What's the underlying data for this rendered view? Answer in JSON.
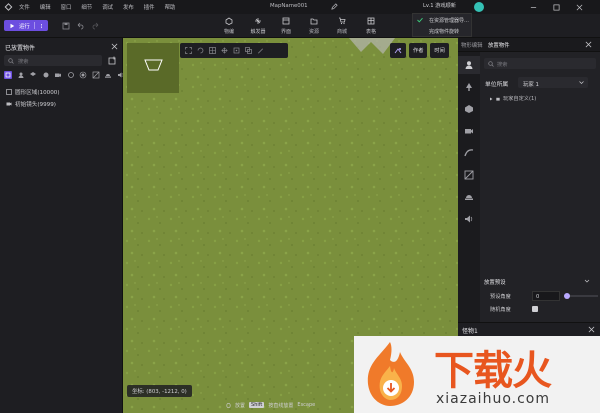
{
  "menubar": {
    "items": [
      "文件",
      "编辑",
      "窗口",
      "细节",
      "调试",
      "发布",
      "插件",
      "帮助"
    ],
    "map_name": "MapName001",
    "level_pill": "Lv.1 游戏顺新"
  },
  "toolbar": {
    "run_label": "运行",
    "tools": [
      "物编",
      "触发器",
      "界面",
      "资源",
      "商城",
      "表格"
    ]
  },
  "notification": {
    "line1": "在资源管理器导…",
    "line2": "完成物件旋转"
  },
  "left_panel": {
    "title": "已放置物件",
    "search_placeholder": "搜索",
    "tree": [
      "圆形区域(10000)",
      "初始镜头(9999)"
    ]
  },
  "viewport": {
    "buttons": [
      "作者",
      "时间"
    ],
    "coords": "坐标:  (803, -1212, 0)"
  },
  "right_panel": {
    "tabs": [
      "物形编辑",
      "放置物件"
    ],
    "search_placeholder": "搜索",
    "owner_label": "单位所属",
    "owner_value": "玩家 1",
    "custom_item": "玩家自定义(1)",
    "place_settings": "放置预设",
    "angle_label": "预设角度",
    "angle_value": "0",
    "angle_fraction": 0.0,
    "random_label": "随机角度"
  },
  "monster_panel": {
    "title": "怪物1"
  },
  "statusbar": {
    "place": "放置",
    "shift_key": "Shift",
    "line_place": "按直线放置",
    "escape": "Escape"
  },
  "watermark": {
    "title": "下载火",
    "subtitle": "xiazaihuo.com"
  },
  "colors": {
    "accent": "#6c4ee0",
    "terrain": "#7a8f3c",
    "watermark_orange": "#e8561f"
  }
}
